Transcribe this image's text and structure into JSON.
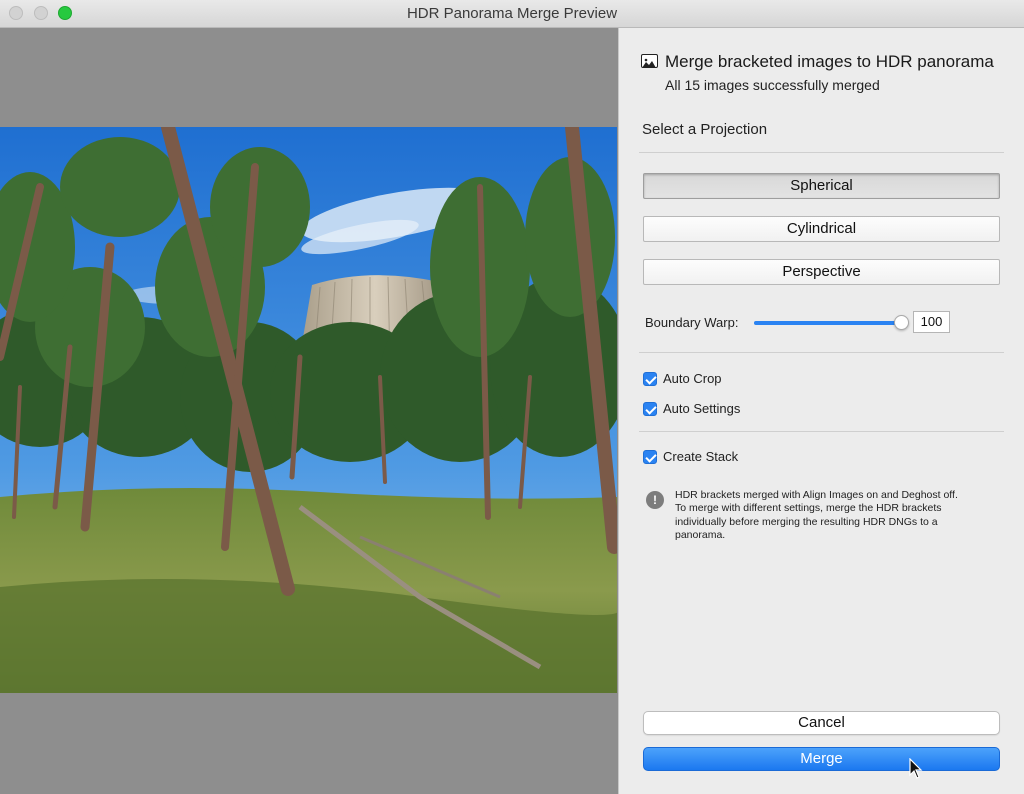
{
  "window": {
    "title": "HDR Panorama Merge Preview"
  },
  "panel": {
    "header": {
      "title": "Merge bracketed images to HDR panorama",
      "status": "All 15 images successfully merged"
    },
    "projection": {
      "heading": "Select a Projection",
      "options": [
        "Spherical",
        "Cylindrical",
        "Perspective"
      ],
      "selected": "Spherical"
    },
    "boundary_warp": {
      "label": "Boundary Warp:",
      "value": "100",
      "fraction": 1.0
    },
    "options": {
      "auto_crop": {
        "label": "Auto Crop",
        "checked": true
      },
      "auto_settings": {
        "label": "Auto Settings",
        "checked": true
      },
      "create_stack": {
        "label": "Create Stack",
        "checked": true
      }
    },
    "info": "HDR brackets merged with Align Images on and Deghost off. To merge with different settings, merge the HDR brackets individually before merging the resulting HDR DNGs to a panorama."
  },
  "buttons": {
    "cancel": "Cancel",
    "merge": "Merge"
  },
  "colors": {
    "accent": "#2a83f2",
    "preview_bg": "#8e8e8e",
    "sky": "#2e7fd6"
  }
}
